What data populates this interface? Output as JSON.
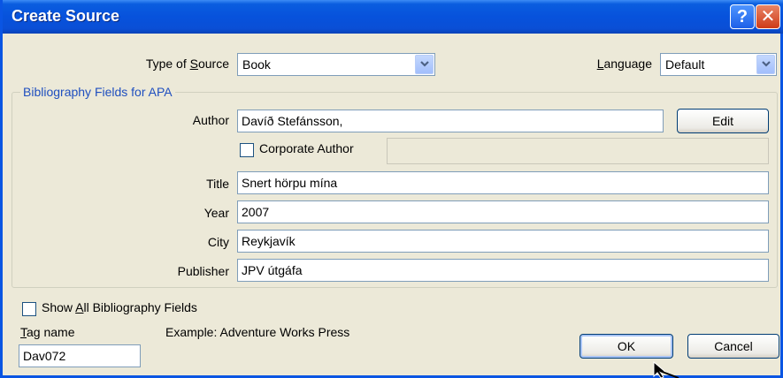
{
  "window": {
    "title": "Create Source",
    "help_glyph": "?",
    "close_glyph": "✕"
  },
  "source": {
    "type_label_pre": "Type of ",
    "type_label_key": "S",
    "type_label_post": "ource",
    "type_value": "Book",
    "language_label_key": "L",
    "language_label_post": "anguage",
    "language_value": "Default"
  },
  "group": {
    "title": "Bibliography Fields for APA",
    "author_label": "Author",
    "author_value": "Davíð Stefánsson,",
    "edit_label": "Edit",
    "corporate_label": "Corporate Author",
    "title_label": "Title",
    "title_value": "Snert hörpu mína",
    "year_label": "Year",
    "year_value": "2007",
    "city_label": "City",
    "city_value": "Reykjavík",
    "publisher_label": "Publisher",
    "publisher_value": "JPV útgáfa"
  },
  "footer": {
    "show_all_pre": "Show ",
    "show_all_key": "A",
    "show_all_post": "ll Bibliography Fields",
    "tag_label_key": "T",
    "tag_label_post": "ag name",
    "tag_value": "Dav072",
    "example": "Example: Adventure Works Press",
    "ok_label": "OK",
    "cancel_label": "Cancel"
  }
}
